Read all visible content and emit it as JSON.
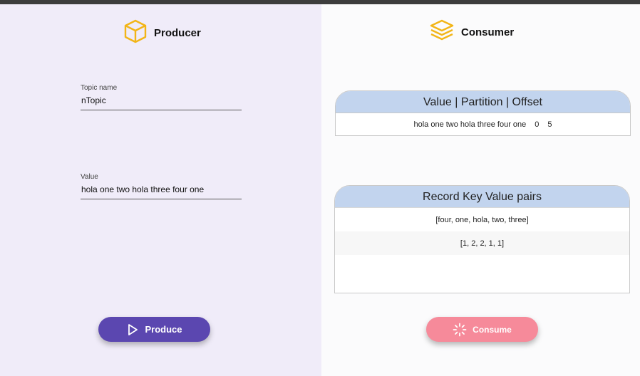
{
  "producer": {
    "title": "Producer",
    "topic_label": "Topic name",
    "topic_value": "nTopic",
    "value_label": "Value",
    "value_value": "hola one two hola three four one",
    "produce_label": "Produce",
    "icon": "cube-icon"
  },
  "consumer": {
    "title": "Consumer",
    "icon": "layers-icon",
    "offset_table": {
      "header": "Value | Partition | Offset",
      "row": {
        "value": "hola one two hola three four one",
        "partition": "0",
        "offset": "5"
      }
    },
    "kv_table": {
      "header": "Record Key Value pairs",
      "rows": [
        "[four, one, hola, two, three]",
        "[1, 2, 2, 1, 1]"
      ]
    },
    "consume_label": "Consume"
  },
  "colors": {
    "produce_button": "#5b47b0",
    "consume_button": "#f68a9a",
    "icon_accent": "#f2b517",
    "table_header": "#c2d4ee"
  }
}
